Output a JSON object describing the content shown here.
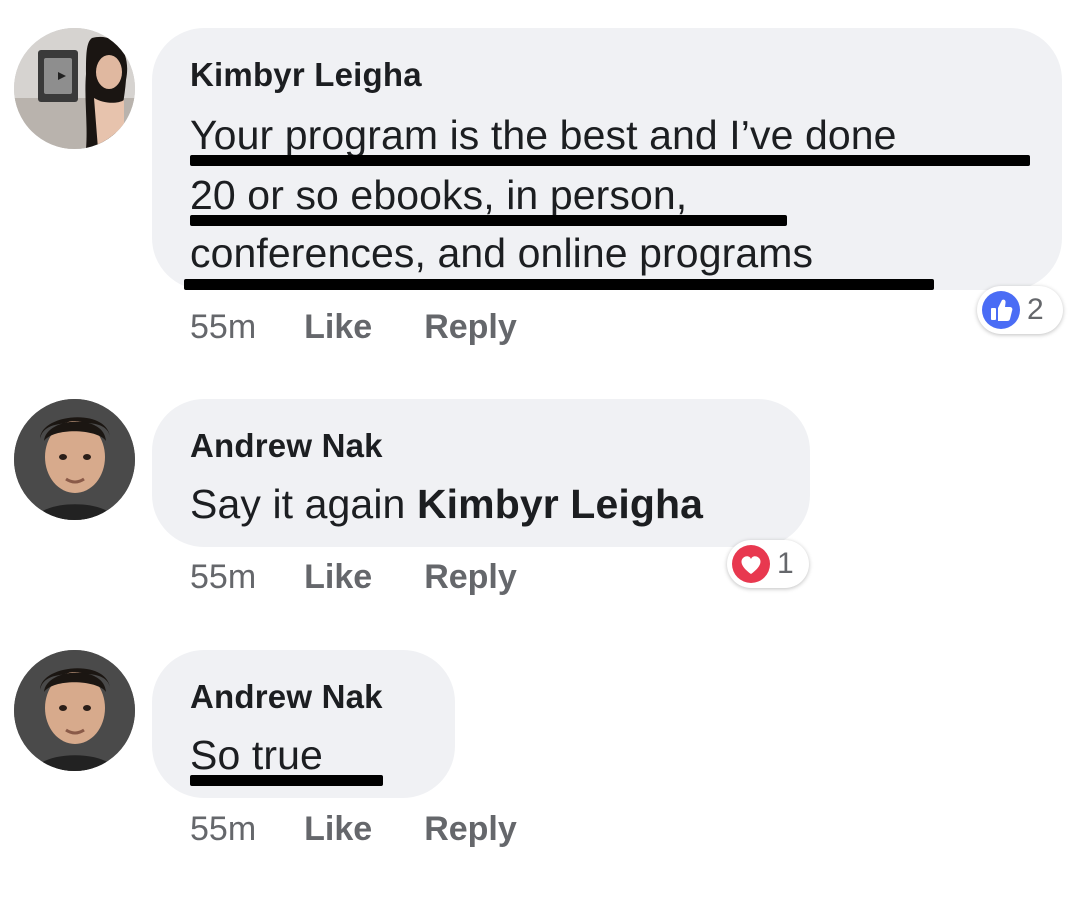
{
  "comments": [
    {
      "author": "Kimbyr Leigha",
      "lines": [
        "Your program is the best and I’ve done",
        "20 or so ebooks, in person,",
        "conferences, and online programs"
      ],
      "time": "55m",
      "like_label": "Like",
      "reply_label": "Reply",
      "reaction": {
        "icon": "thumbs-up-icon",
        "count": "2",
        "color": "#4267f2"
      }
    },
    {
      "author": "Andrew Nak",
      "text": "Say it again ",
      "mention": "Kimbyr Leigha",
      "time": "55m",
      "like_label": "Like",
      "reply_label": "Reply",
      "reaction": {
        "icon": "heart-icon",
        "count": "1",
        "color": "#e8384f"
      }
    },
    {
      "author": "Andrew Nak",
      "text": "So true",
      "time": "55m",
      "like_label": "Like",
      "reply_label": "Reply"
    }
  ]
}
